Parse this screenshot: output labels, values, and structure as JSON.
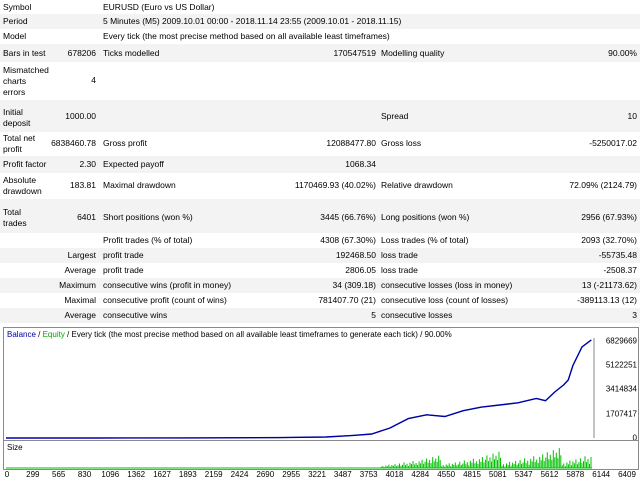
{
  "report": {
    "symbol_label": "Symbol",
    "symbol_value": "EURUSD (Euro vs US Dollar)",
    "period_label": "Period",
    "period_value": "5 Minutes (M5) 2009.10.01 00:00 - 2018.11.14 23:55 (2009.10.01 - 2018.11.15)",
    "model_label": "Model",
    "model_value": "Every tick (the most precise method based on all available least timeframes)",
    "bars_label": "Bars in test",
    "bars_value": "678206",
    "ticks_label": "Ticks modelled",
    "ticks_value": "170547519",
    "quality_label": "Modelling quality",
    "quality_value": "90.00%",
    "mismatched_label_1": "Mismatched",
    "mismatched_label_2": "charts",
    "mismatched_label_3": "errors",
    "mismatched_value": "4",
    "initial_label_1": "Initial",
    "initial_label_2": "deposit",
    "initial_value": "1000.00",
    "spread_label": "Spread",
    "spread_value": "10",
    "net_label_1": "Total net",
    "net_label_2": "profit",
    "net_value": "6838460.78",
    "gross_profit_label": "Gross profit",
    "gross_profit_value": "12088477.80",
    "gross_loss_label": "Gross loss",
    "gross_loss_value": "-5250017.02",
    "pf_label": "Profit factor",
    "pf_value": "2.30",
    "ep_label": "Expected payoff",
    "ep_value": "1068.34",
    "abs_dd_label_1": "Absolute",
    "abs_dd_label_2": "drawdown",
    "abs_dd_value": "183.81",
    "max_dd_label": "Maximal drawdown",
    "max_dd_value": "1170469.93 (40.02%)",
    "rel_dd_label": "Relative drawdown",
    "rel_dd_value": "72.09% (2124.79)",
    "trades_label_1": "Total",
    "trades_label_2": "trades",
    "trades_value": "6401",
    "short_label": "Short positions (won %)",
    "short_value": "3445 (66.76%)",
    "long_label": "Long positions (won %)",
    "long_value": "2956 (67.93%)",
    "profit_trades_label": "Profit trades (% of total)",
    "profit_trades_value": "4308 (67.30%)",
    "loss_trades_label": "Loss trades (% of total)",
    "loss_trades_value": "2093 (32.70%)",
    "largest_label": "Largest",
    "largest_profit_label": "profit trade",
    "largest_profit_value": "192468.50",
    "largest_loss_label": "loss trade",
    "largest_loss_value": "-55735.48",
    "average_label": "Average",
    "average_profit_label": "profit trade",
    "average_profit_value": "2806.05",
    "average_loss_label": "loss trade",
    "average_loss_value": "-2508.37",
    "maximum_label": "Maximum",
    "max_cons_wins_label": "consecutive wins (profit in money)",
    "max_cons_wins_value": "34 (309.18)",
    "max_cons_losses_label": "consecutive losses (loss in money)",
    "max_cons_losses_value": "13 (-21173.62)",
    "maximal_label": "Maximal",
    "maximal_cons_profit_label": "consecutive profit (count of wins)",
    "maximal_cons_profit_value": "781407.70 (21)",
    "maximal_cons_loss_label": "consecutive loss (count of losses)",
    "maximal_cons_loss_value": "-389113.13 (12)",
    "average2_label": "Average",
    "avg_cons_wins_label": "consecutive wins",
    "avg_cons_wins_value": "5",
    "avg_cons_losses_label": "consecutive losses",
    "avg_cons_losses_value": "3"
  },
  "chart": {
    "legend_balance": "Balance",
    "legend_sep1": " / ",
    "legend_equity": "Equity",
    "legend_rest": " / Every tick (the most precise method based on all available least timeframes to generate each tick) / 90.00%",
    "size_label": "Size",
    "y_ticks": [
      "6829669",
      "5122251",
      "3414834",
      "1707417",
      "0"
    ],
    "x_ticks": [
      "0",
      "299",
      "565",
      "830",
      "1096",
      "1362",
      "1627",
      "1893",
      "2159",
      "2424",
      "2690",
      "2955",
      "3221",
      "3487",
      "3753",
      "4018",
      "4284",
      "4550",
      "4815",
      "5081",
      "5347",
      "5612",
      "5878",
      "6144",
      "6409"
    ],
    "colors": {
      "balance": "#0000a8",
      "equity": "#00a800",
      "size": "#00c000"
    }
  },
  "chart_data": {
    "type": "line",
    "series": [
      {
        "name": "Balance",
        "x": [
          0,
          1000,
          2000,
          3000,
          3500,
          3800,
          4000,
          4200,
          4400,
          4600,
          4800,
          5000,
          5200,
          5400,
          5600,
          5800,
          5900,
          6000,
          6100,
          6150,
          6200,
          6300,
          6401
        ],
        "values": [
          1000,
          1000,
          5000,
          30000,
          70000,
          180000,
          280000,
          700000,
          1350000,
          1620000,
          1500000,
          1900000,
          2150000,
          2300000,
          2450000,
          2750000,
          2600000,
          3200000,
          3700000,
          4050000,
          5050000,
          6350000,
          6838461
        ]
      },
      {
        "name": "Equity",
        "x": [
          0,
          1000,
          2000,
          3000,
          3500,
          3800,
          4000,
          4200,
          4400,
          4600,
          4800,
          5000,
          5200,
          5400,
          5600,
          5800,
          5900,
          6000,
          6100,
          6150,
          6200,
          6300,
          6401
        ],
        "values": [
          1000,
          1000,
          5000,
          30000,
          70000,
          180000,
          280000,
          700000,
          1350000,
          1620000,
          1500000,
          1900000,
          2150000,
          2300000,
          2450000,
          2750000,
          2600000,
          3200000,
          3700000,
          4050000,
          5050000,
          6350000,
          6838461
        ]
      }
    ],
    "xlim": [
      0,
      6409
    ],
    "ylim": [
      0,
      6829669
    ],
    "xlabel": "",
    "ylabel": "",
    "grid": false,
    "legend_placement": "top-left"
  }
}
